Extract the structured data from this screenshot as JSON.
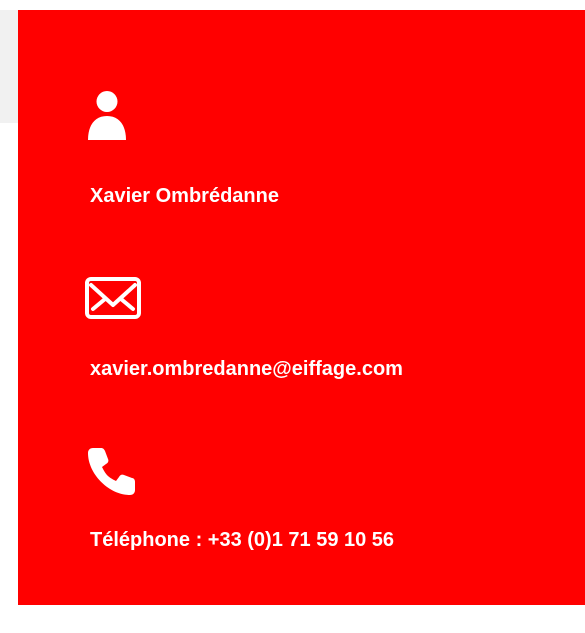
{
  "contact": {
    "name": "Xavier Ombrédanne",
    "email": "xavier.ombredanne@eiffage.com",
    "phone": "Téléphone : +33 (0)1 71 59 10 56"
  },
  "icons": {
    "person": "user-icon",
    "mail": "mail-icon",
    "phone": "phone-icon"
  },
  "colors": {
    "card_background": "#ff0000",
    "text": "#ffffff"
  }
}
